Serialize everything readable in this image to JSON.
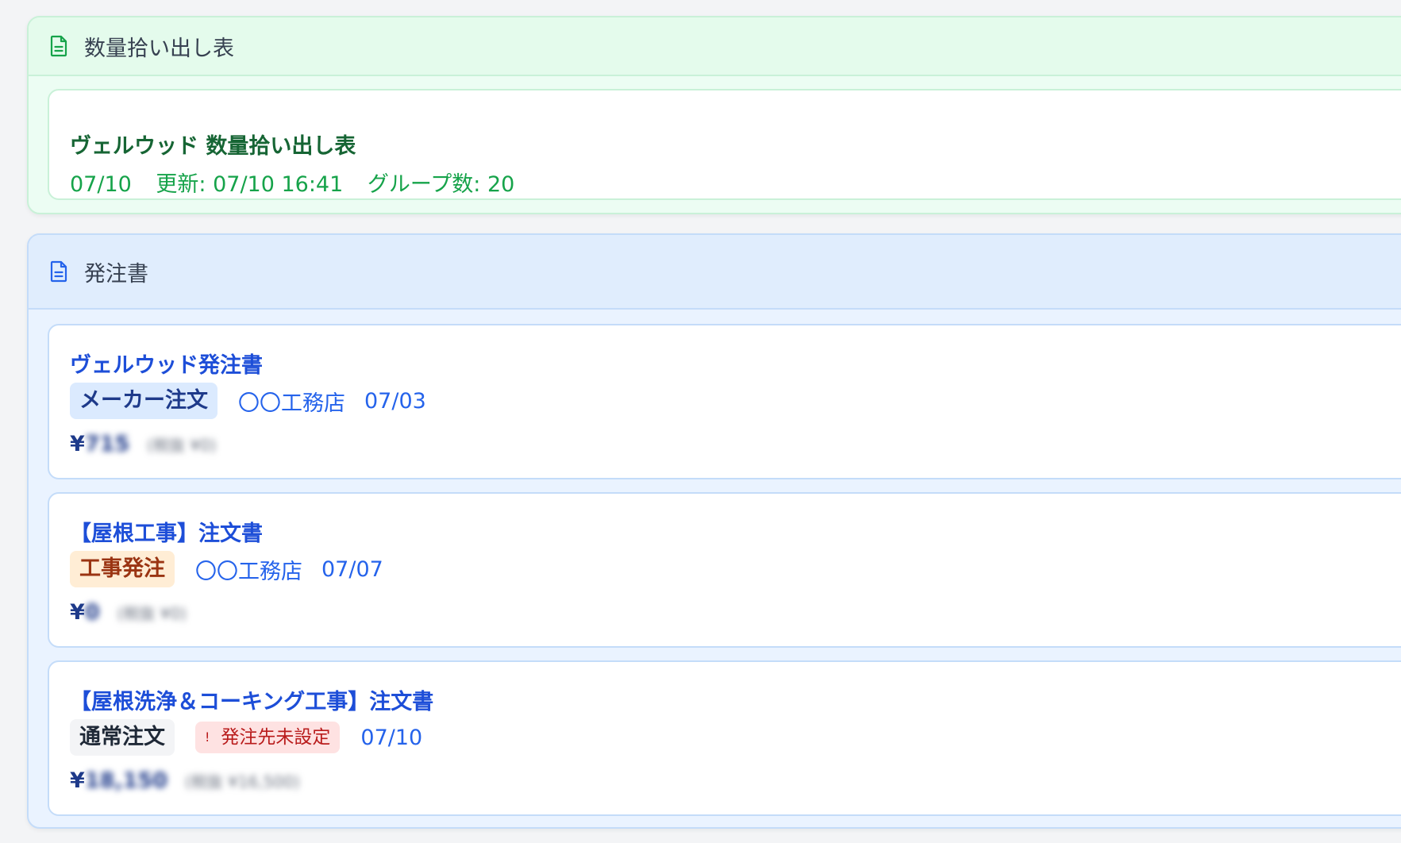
{
  "quantity_panel": {
    "header_title": "数量拾い出し表",
    "card": {
      "title": "ヴェルウッド 数量拾い出し表",
      "date": "07/10",
      "updated": "更新: 07/10 16:41",
      "groups": "グループ数: 20"
    }
  },
  "order_panel": {
    "header_title": "発注書",
    "orders": [
      {
        "title": "ヴェルウッド発注書",
        "badge": "メーカー注文",
        "vendor": "〇〇工務店",
        "date": "07/03",
        "currency": "¥",
        "amount": "715",
        "tax": "(税抜 ¥0)"
      },
      {
        "title": "【屋根工事】注文書",
        "badge": "工事発注",
        "vendor": "〇〇工務店",
        "date": "07/07",
        "currency": "¥",
        "amount": "0",
        "tax": "(税抜 ¥0)"
      },
      {
        "title": "【屋根洗浄＆コーキング工事】注文書",
        "badge": "通常注文",
        "warning": "発注先未設定",
        "warning_dot": "!",
        "date": "07/10",
        "currency": "¥",
        "amount": "18,150",
        "tax": "(税抜 ¥16,500)"
      }
    ]
  },
  "colors": {
    "green_accent": "#16a34a",
    "blue_accent": "#2563eb",
    "warning": "#b91c1c"
  },
  "icons": {
    "panel_header": "document-icon"
  }
}
